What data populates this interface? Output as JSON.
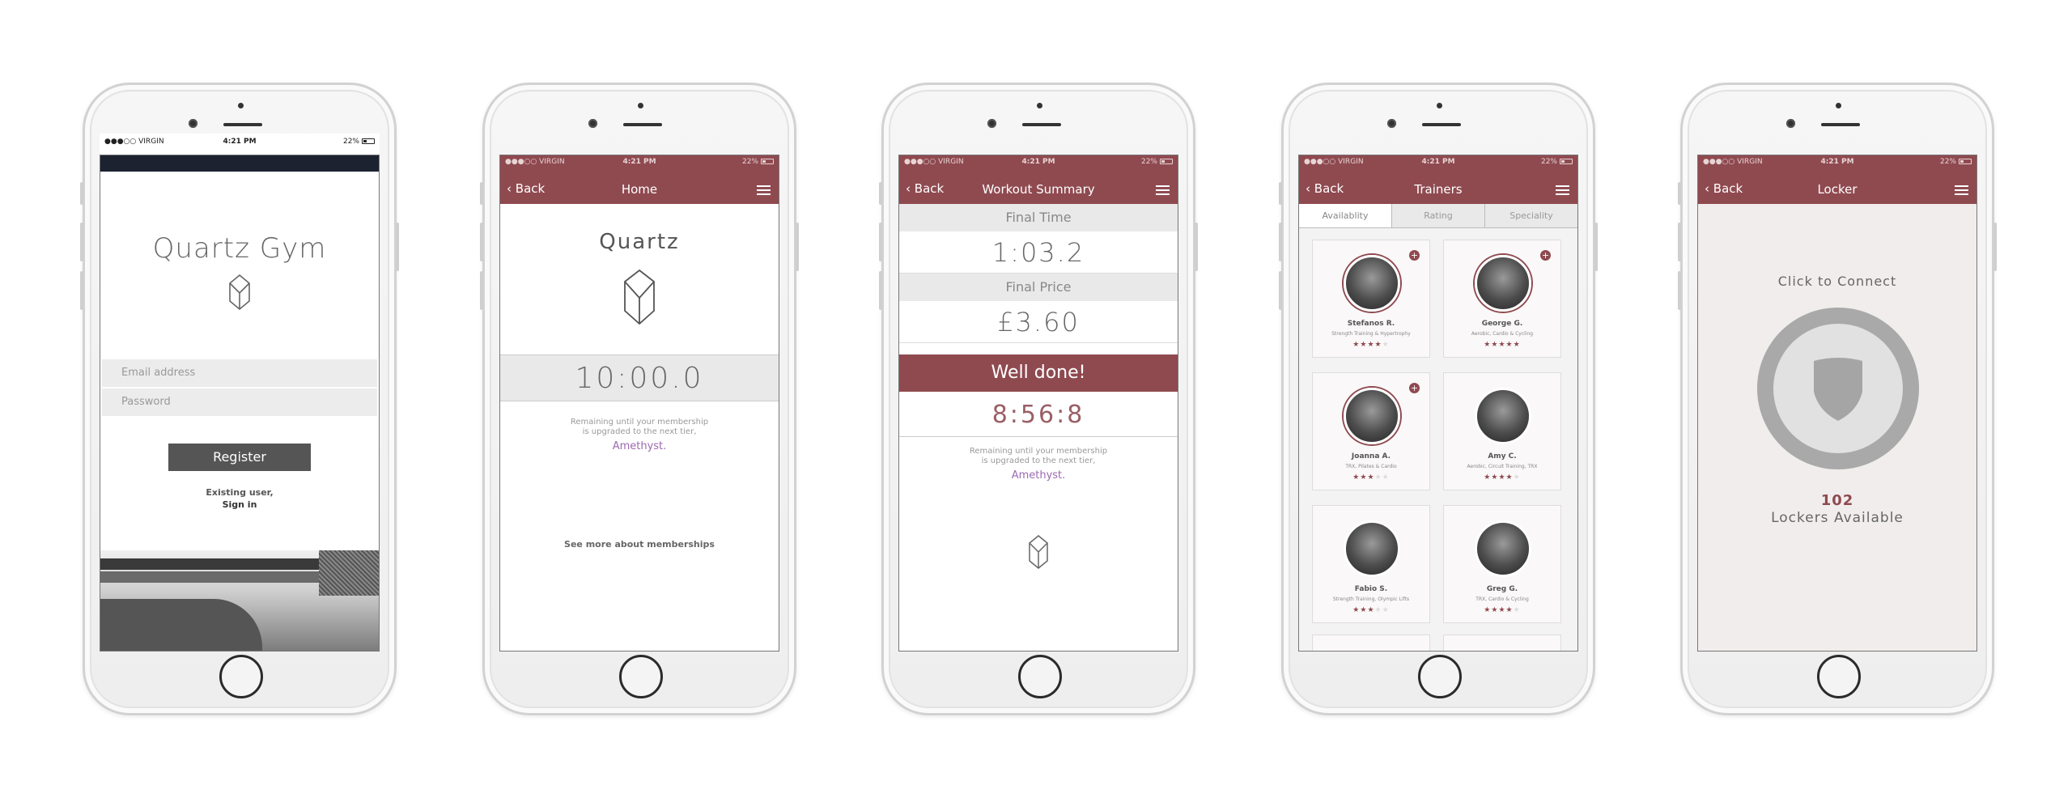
{
  "colors": {
    "accent": "#8f4a50",
    "amethyst": "#9b6ab0",
    "grey_bar": "#555555",
    "banner": "#8f4a50"
  },
  "status": {
    "carrier": "●●●○○ VIRGIN",
    "time": "4:21 PM",
    "battery": "22%"
  },
  "screen1": {
    "app_title": "Quartz Gym",
    "icon": "gem-icon",
    "email_placeholder": "Email address",
    "password_placeholder": "Password",
    "register_label": "Register",
    "existing_line": "Existing user,",
    "signin_label": "Sign in"
  },
  "screen2": {
    "back_label": "Back",
    "title": "Home",
    "brand": "Quartz",
    "timer": "10:00.0",
    "remaining_line1": "Remaining until your membership",
    "remaining_line2": "is upgraded to the next tier,",
    "tier": "Amethyst.",
    "more_link": "See more about memberships"
  },
  "screen3": {
    "back_label": "Back",
    "title": "Workout Summary",
    "final_time_label": "Final Time",
    "final_time": "1:03.2",
    "final_price_label": "Final Price",
    "final_price": "£3.60",
    "banner": "Well done!",
    "remaining_time": "8:56:8",
    "remaining_line1": "Remaining until your membership",
    "remaining_line2": "is upgraded to the next tier,",
    "tier": "Amethyst."
  },
  "screen4": {
    "back_label": "Back",
    "title": "Trainers",
    "tabs": [
      "Availablity",
      "Rating",
      "Speciality"
    ],
    "trainers": [
      {
        "name": "Stefanos R.",
        "spec": "Strength Training & Hypertrophy",
        "rating": 4
      },
      {
        "name": "George G.",
        "spec": "Aerobic, Cardio & Cycling",
        "rating": 5
      },
      {
        "name": "Joanna A.",
        "spec": "TRX, Pilates & Cardio",
        "rating": 3
      },
      {
        "name": "Amy C.",
        "spec": "Aerobic, Circuit Training, TRX",
        "rating": 4
      },
      {
        "name": "Fabio S.",
        "spec": "Strength Training, Olympic Lifts",
        "rating": 3
      },
      {
        "name": "Greg G.",
        "spec": "TRX, Cardio & Cycling",
        "rating": 4
      }
    ]
  },
  "screen5": {
    "back_label": "Back",
    "title": "Locker",
    "connect_label": "Click to Connect",
    "locker_count": "102",
    "locker_label": "Lockers Available"
  }
}
